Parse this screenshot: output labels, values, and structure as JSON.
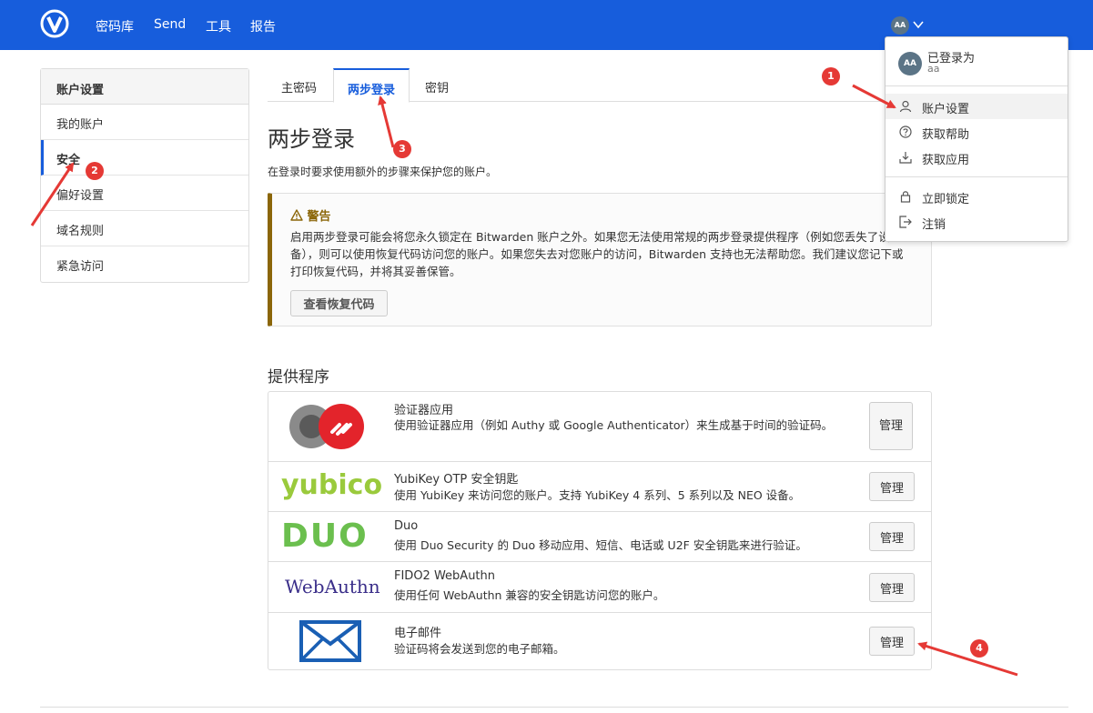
{
  "nav": {
    "items": [
      {
        "label": "密码库"
      },
      {
        "label": "Send"
      },
      {
        "label": "工具"
      },
      {
        "label": "报告"
      }
    ],
    "avatar": "AA"
  },
  "sidebar": {
    "title": "账户设置",
    "items": [
      {
        "label": "我的账户"
      },
      {
        "label": "安全"
      },
      {
        "label": "偏好设置"
      },
      {
        "label": "域名规则"
      },
      {
        "label": "紧急访问"
      }
    ]
  },
  "tabs": [
    {
      "label": "主密码"
    },
    {
      "label": "两步登录"
    },
    {
      "label": "密钥"
    }
  ],
  "page": {
    "title": "两步登录",
    "description": "在登录时要求使用额外的步骤来保护您的账户。"
  },
  "warning": {
    "title": "警告",
    "text": "启用两步登录可能会将您永久锁定在 Bitwarden 账户之外。如果您无法使用常规的两步登录提供程序（例如您丢失了设备），则可以使用恢复代码访问您的账户。如果您失去对您账户的访问，Bitwarden 支持也无法帮助您。我们建议您记下或打印恢复代码，并将其妥善保管。",
    "button": "查看恢复代码"
  },
  "providers": {
    "title": "提供程序",
    "manage_label": "管理",
    "items": [
      {
        "name": "验证器应用",
        "description": "使用验证器应用（例如 Authy 或 Google Authenticator）来生成基于时间的验证码。",
        "logo": "authenticator-logo"
      },
      {
        "name": "YubiKey OTP 安全钥匙",
        "description": "使用 YubiKey 来访问您的账户。支持 YubiKey 4 系列、5 系列以及 NEO 设备。",
        "logo": "yubico-logo",
        "logo_text": "yubico"
      },
      {
        "name": "Duo",
        "description": "使用 Duo Security 的 Duo 移动应用、短信、电话或 U2F 安全钥匙来进行验证。",
        "logo": "duo-logo",
        "logo_text": "DUO"
      },
      {
        "name": "FIDO2 WebAuthn",
        "description": "使用任何 WebAuthn 兼容的安全钥匙访问您的账户。",
        "logo": "webauthn-logo",
        "logo_text": "WebAuthn"
      },
      {
        "name": "电子邮件",
        "description": "验证码将会发送到您的电子邮箱。",
        "logo": "email-logo"
      }
    ]
  },
  "dropdown": {
    "avatar": "AA",
    "logged_in_as": "已登录为",
    "username": "aa",
    "items": [
      {
        "label": "账户设置",
        "icon": "user-icon"
      },
      {
        "label": "获取帮助",
        "icon": "question-icon"
      },
      {
        "label": "获取应用",
        "icon": "download-icon"
      },
      {
        "label": "立即锁定",
        "icon": "lock-icon"
      },
      {
        "label": "注销",
        "icon": "logout-icon"
      }
    ]
  },
  "annotations": [
    "1",
    "2",
    "3",
    "4"
  ],
  "colors": {
    "brand": "#175ddc",
    "warning": "#8b6609",
    "annotation": "#e53935",
    "yubico": "#9aca3c",
    "duo": "#6bbf4e",
    "webauthn": "#3b2f8a",
    "email": "#1a5fb4"
  }
}
